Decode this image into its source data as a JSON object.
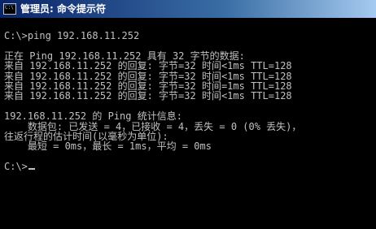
{
  "window": {
    "title": "管理员: 命令提示符",
    "icon": "cmd-icon",
    "icon_label": "C:\\"
  },
  "console": {
    "lines": [
      "C:\\>ping 192.168.11.252",
      "",
      "正在 Ping 192.168.11.252 具有 32 字节的数据:",
      "来自 192.168.11.252 的回复: 字节=32 时间<1ms TTL=128",
      "来自 192.168.11.252 的回复: 字节=32 时间<1ms TTL=128",
      "来自 192.168.11.252 的回复: 字节=32 时间=1ms TTL=128",
      "来自 192.168.11.252 的回复: 字节=32 时间<1ms TTL=128",
      "",
      "192.168.11.252 的 Ping 统计信息:",
      "    数据包: 已发送 = 4，已接收 = 4，丢失 = 0 (0% 丢失)，",
      "往返行程的估计时间(以毫秒为单位):",
      "    最短 = 0ms，最长 = 1ms，平均 = 0ms",
      "",
      "C:\\>"
    ]
  },
  "colors": {
    "background": "#000000",
    "text": "#c0c0c0",
    "titlebar_start": "#0a246a",
    "titlebar_end": "#a6caf0"
  }
}
